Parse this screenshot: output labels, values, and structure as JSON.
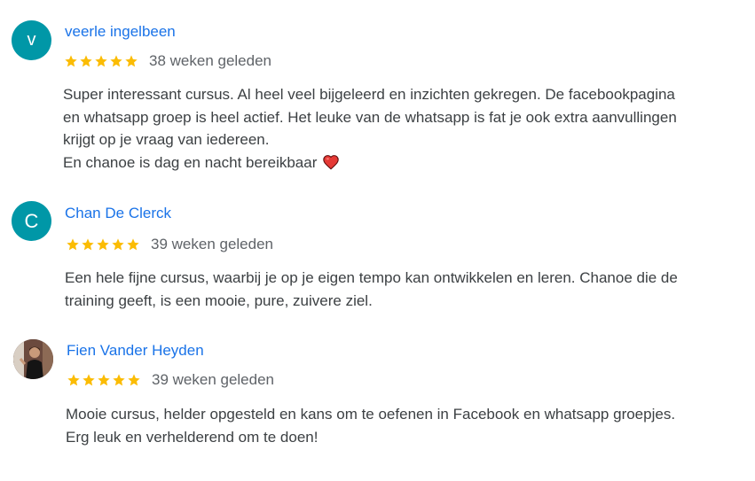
{
  "colors": {
    "author_link": "#1a73e8",
    "star": "#fbbc04",
    "avatar_bg": "#0097a7",
    "text": "#3c4043",
    "meta": "#5f6368",
    "heart": "#e53935"
  },
  "reviews": [
    {
      "avatar_letter": "v",
      "author": "veerle ingelbeen",
      "rating": 5,
      "date": "38 weken geleden",
      "lines": [
        "Super interessant cursus. Al heel veel bijgeleerd en inzichten gekregen. De facebookpagina",
        "en whatsapp groep is heel actief. Het leuke van de whatsapp is fat je ook extra aanvullingen",
        "krijgt op je vraag van iedereen.",
        "En chanoe is dag en nacht bereikbaar"
      ],
      "trailing_icon": "red-heart-icon"
    },
    {
      "avatar_letter": "C",
      "author": "Chan De Clerck",
      "rating": 5,
      "date": "39 weken geleden",
      "lines": [
        "Een hele fijne cursus, waarbij je op je eigen tempo kan ontwikkelen en leren. Chanoe die de",
        "training geeft, is een mooie, pure, zuivere ziel."
      ]
    },
    {
      "avatar_letter": "",
      "avatar_icon": "profile-photo",
      "author": "Fien Vander Heyden",
      "rating": 5,
      "date": "39 weken geleden",
      "lines": [
        "Mooie cursus, helder opgesteld en kans om te oefenen in Facebook en whatsapp groepjes.",
        "Erg leuk en verhelderend om te doen!"
      ]
    }
  ]
}
